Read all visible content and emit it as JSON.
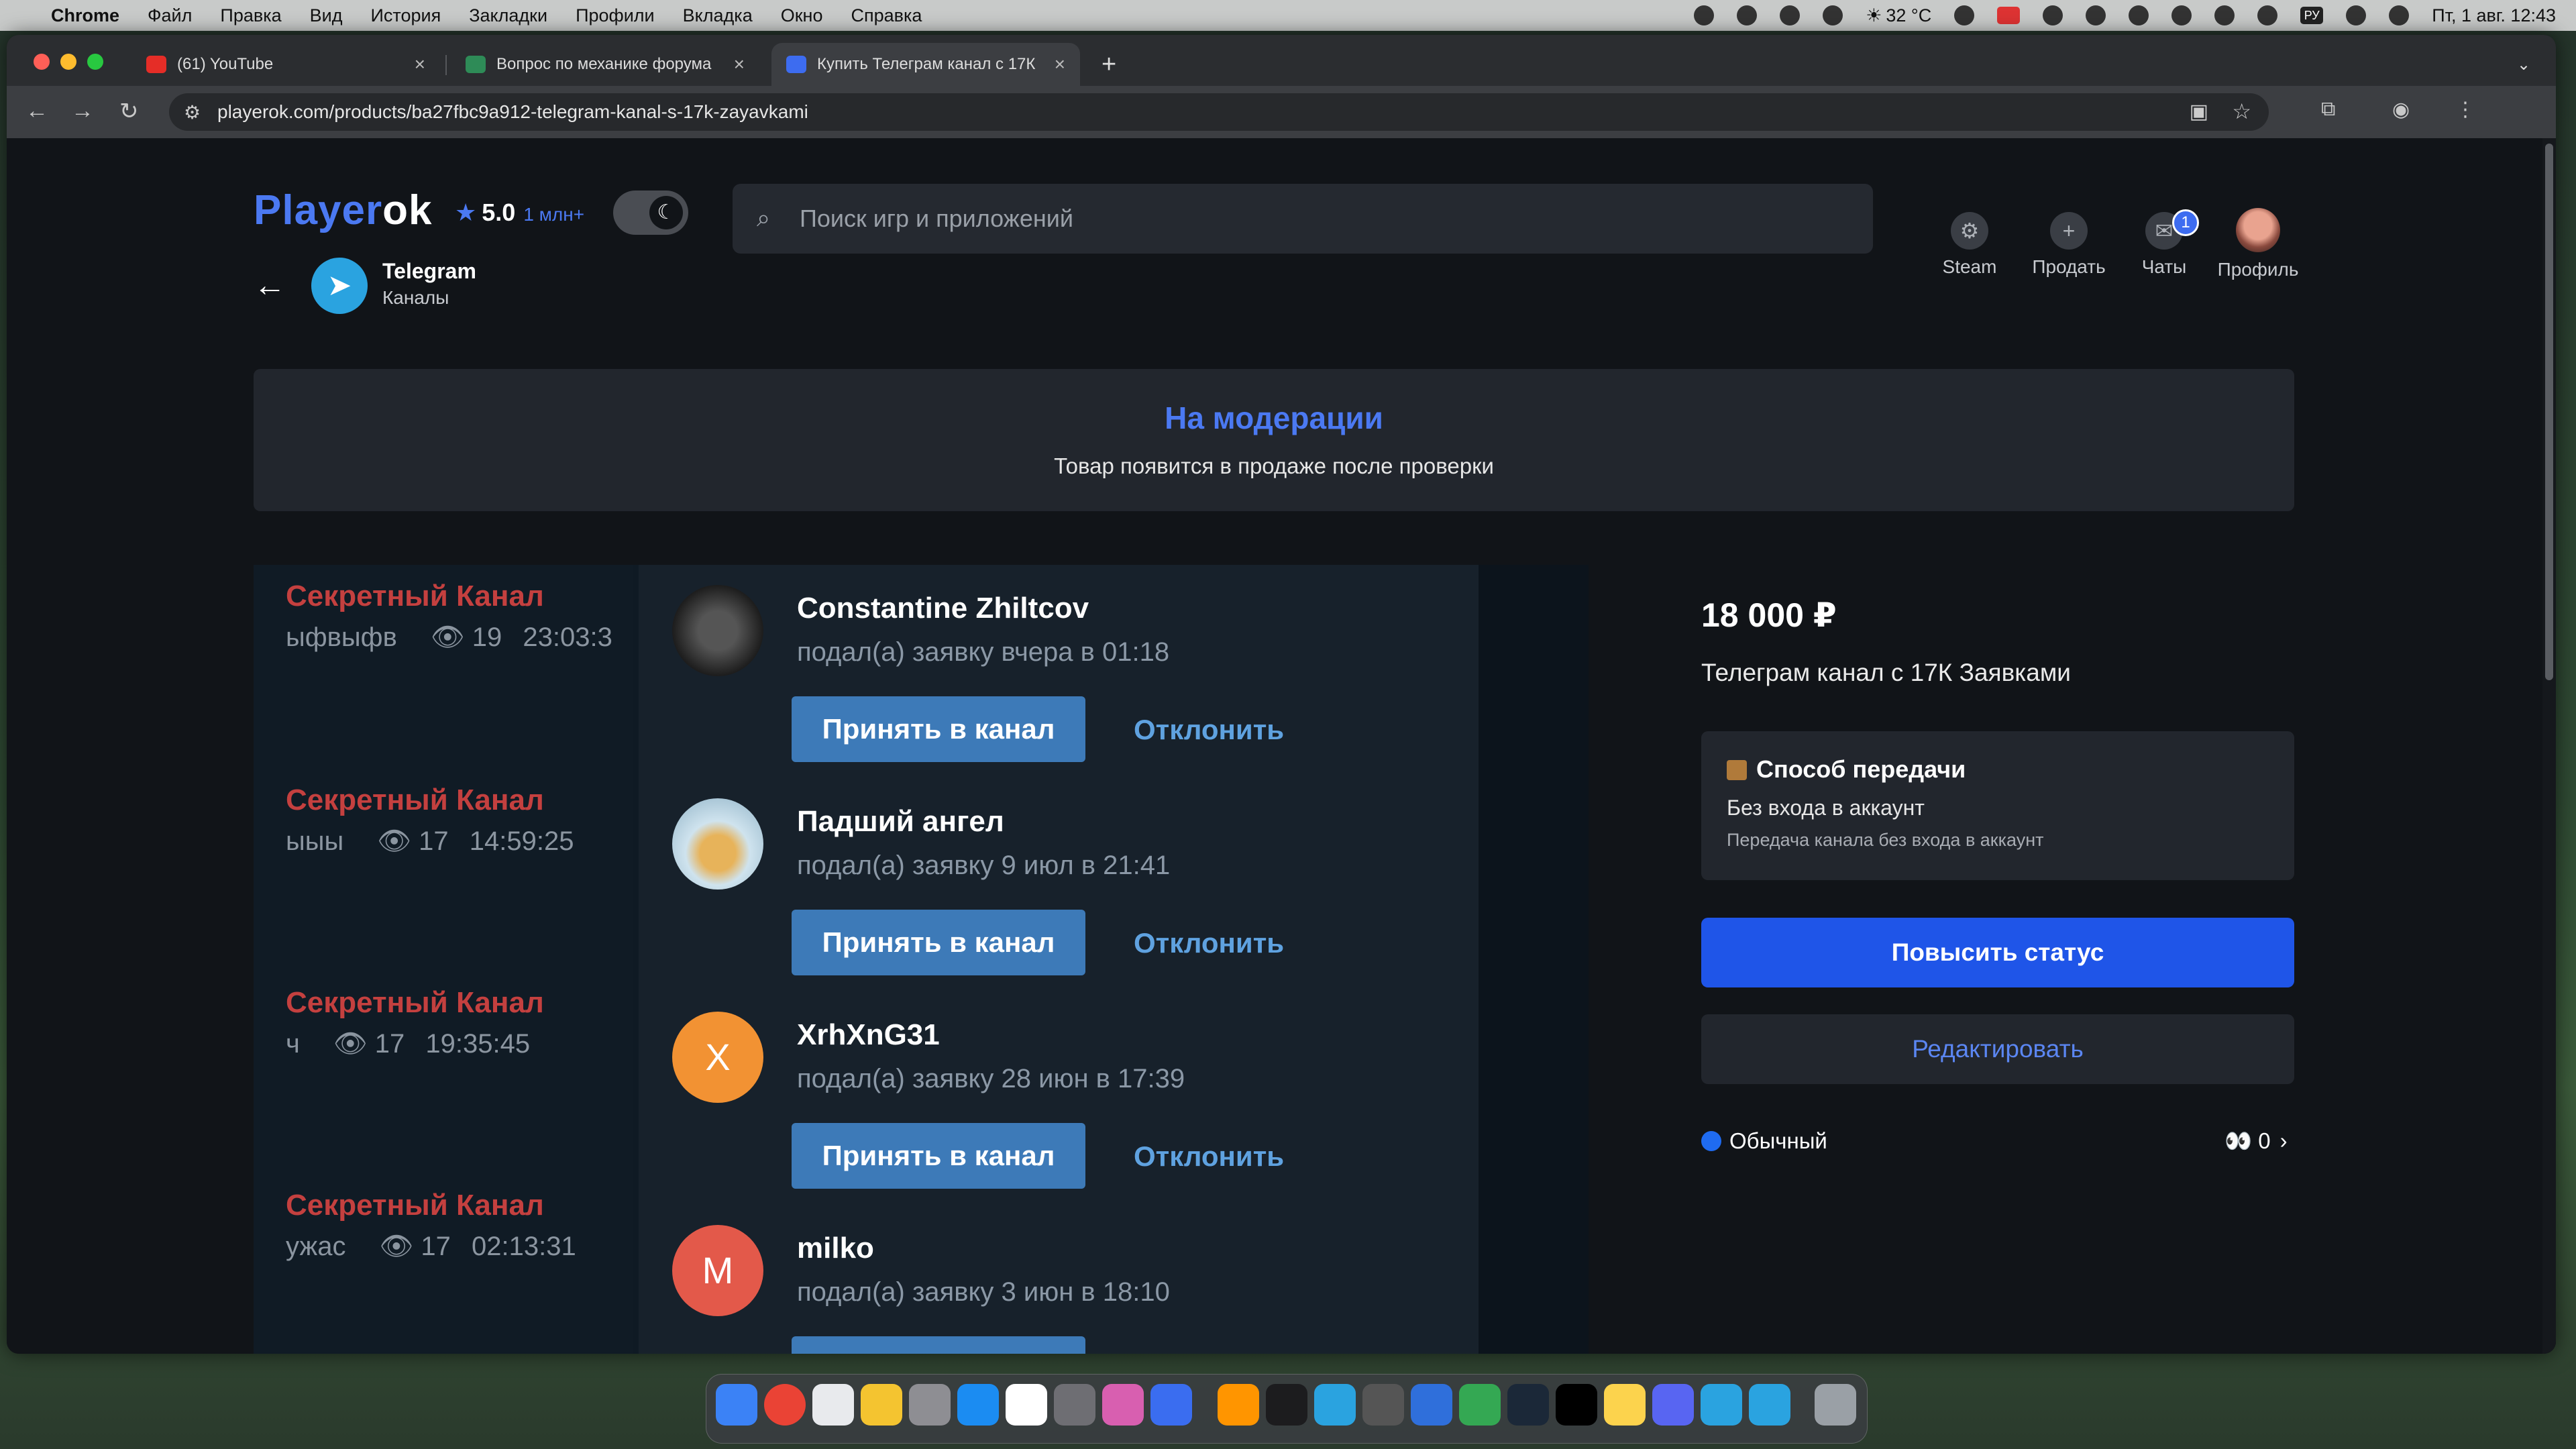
{
  "menubar": {
    "app": "Chrome",
    "items": [
      "Файл",
      "Правка",
      "Вид",
      "История",
      "Закладки",
      "Профили",
      "Вкладка",
      "Окно",
      "Справка"
    ],
    "weather": "32 °C",
    "input_lang": "РУ",
    "datetime": "Пт, 1 авг. 12:43"
  },
  "browser": {
    "tabs": [
      {
        "title": "(61) YouTube",
        "favicon": "youtube-icon",
        "color": "#e52d27"
      },
      {
        "title": "Вопрос по механике форума",
        "favicon": "forum-icon",
        "color": "#2e8b57"
      },
      {
        "title": "Купить Телеграм канал с 17К",
        "favicon": "playerok-icon",
        "color": "#3d6cf0"
      }
    ],
    "url": "playerok.com/products/ba27fbc9a912-telegram-kanal-s-17k-zayavkami"
  },
  "header": {
    "logo_a": "Player",
    "logo_b": "ok",
    "rating": "5.0",
    "reviews": "1 млн+",
    "search_placeholder": "Поиск игр и приложений",
    "nav": [
      {
        "label": "Steam",
        "icon": "steam-icon"
      },
      {
        "label": "Продать",
        "icon": "plus-icon"
      },
      {
        "label": "Чаты",
        "icon": "chat-icon",
        "badge": "1"
      },
      {
        "label": "Профиль",
        "icon": "avatar"
      }
    ]
  },
  "breadcrumb": {
    "title": "Telegram",
    "subtitle": "Каналы"
  },
  "moderation": {
    "title": "На модерации",
    "subtitle": "Товар появится в продаже после проверки"
  },
  "screenshot": {
    "left_items": [
      {
        "title": "Секретный Канал",
        "text": "ыфвыфв",
        "views": "19",
        "time": "23:03:3"
      },
      {
        "title": "Секретный Канал",
        "text": "ыыы",
        "views": "17",
        "time": "14:59:25"
      },
      {
        "title": "Секретный Канал",
        "text": "ч",
        "views": "17",
        "time": "19:35:45"
      },
      {
        "title": "Секретный Канал",
        "text": "ужас",
        "views": "17",
        "time": "02:13:31"
      }
    ],
    "requests": [
      {
        "name": "Constantine Zhiltcov",
        "sub": "подал(а) заявку вчера в 01:18",
        "initial": "",
        "color": "#2a2a2a"
      },
      {
        "name": "Падший ангел",
        "sub": "подал(а) заявку 9 июл в 21:41",
        "initial": "",
        "color": "#9fc3d8"
      },
      {
        "name": "XrhXnG31",
        "sub": "подал(а) заявку 28 июн в 17:39",
        "initial": "X",
        "color": "#f29233"
      },
      {
        "name": "milko",
        "sub": "подал(а) заявку 3 июн в 18:10",
        "initial": "M",
        "color": "#e3594a"
      }
    ],
    "accept_label": "Принять в канал",
    "reject_label": "Отклонить"
  },
  "product": {
    "price": "18 000 ₽",
    "title": "Телеграм канал с 17К Заявками",
    "method_title": "Способ передачи",
    "method_value": "Без входа в аккаунт",
    "method_note": "Передача канала без входа в аккаунт",
    "boost_label": "Повысить статус",
    "edit_label": "Редактировать",
    "plan": "Обычный",
    "views": "0"
  }
}
